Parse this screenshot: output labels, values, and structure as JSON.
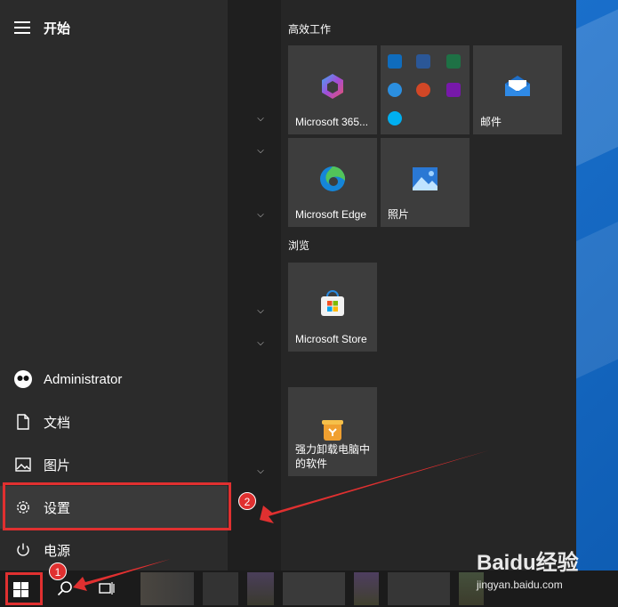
{
  "start_menu": {
    "title": "开始",
    "left_items": [
      {
        "id": "user",
        "label": "Administrator",
        "icon": "user-avatar-icon"
      },
      {
        "id": "documents",
        "label": "文档",
        "icon": "document-icon"
      },
      {
        "id": "pictures",
        "label": "图片",
        "icon": "picture-icon"
      },
      {
        "id": "settings",
        "label": "设置",
        "icon": "gear-icon"
      },
      {
        "id": "power",
        "label": "电源",
        "icon": "power-icon"
      }
    ],
    "groups": [
      {
        "label": "高效工作",
        "tiles": [
          {
            "label": "Microsoft 365...",
            "icon": "microsoft-365-icon"
          },
          {
            "label": "",
            "icon": "office-apps-folder-icon"
          },
          {
            "label": "邮件",
            "icon": "mail-icon"
          },
          {
            "label": "Microsoft Edge",
            "icon": "edge-icon"
          },
          {
            "label": "照片",
            "icon": "photos-icon"
          }
        ]
      },
      {
        "label": "浏览",
        "tiles": [
          {
            "label": "Microsoft Store",
            "icon": "store-icon"
          }
        ]
      },
      {
        "label": "",
        "tiles": [
          {
            "label": "强力卸载电脑中的软件",
            "icon": "uninstall-icon"
          }
        ]
      }
    ]
  },
  "annotations": [
    {
      "number": "1",
      "target": "start-button"
    },
    {
      "number": "2",
      "target": "settings"
    }
  ],
  "watermark": {
    "brand": "Baidu经验",
    "url": "jingyan.baidu.com"
  },
  "colors": {
    "highlight": "#e03030",
    "menu_bg": "#262626",
    "tile_bg": "#3d3d3d"
  }
}
